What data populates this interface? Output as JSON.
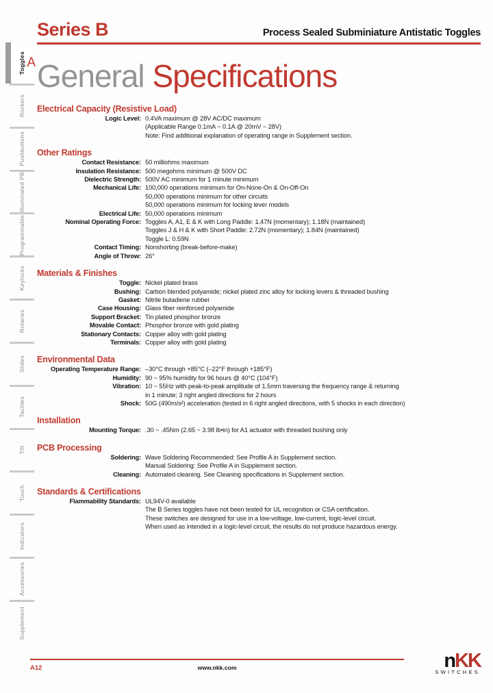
{
  "header": {
    "series": "Series B",
    "subtitle": "Process Sealed Subminiature Antistatic Toggles",
    "title_gray": "General ",
    "title_red": "Specifications"
  },
  "sidebar": {
    "active_letter": "A",
    "items": [
      {
        "label": "Toggles",
        "active": true
      },
      {
        "label": "Rockers",
        "active": false
      },
      {
        "label": "Pushbuttons",
        "active": false
      },
      {
        "label": "Illuminated PB",
        "active": false
      },
      {
        "label": "Programmable",
        "active": false
      },
      {
        "label": "Keylocks",
        "active": false
      },
      {
        "label": "Rotaries",
        "active": false
      },
      {
        "label": "Slides",
        "active": false
      },
      {
        "label": "Tactiles",
        "active": false
      },
      {
        "label": "Tilt",
        "active": false
      },
      {
        "label": "Touch",
        "active": false
      },
      {
        "label": "Indicators",
        "active": false
      },
      {
        "label": "Accessories",
        "active": false
      },
      {
        "label": "Supplement",
        "active": false
      }
    ]
  },
  "sections": [
    {
      "title": "Electrical Capacity (Resistive Load)",
      "rows": [
        {
          "label": "Logic Level:",
          "values": [
            "0.4VA maximum @ 28V AC/DC maximum",
            "(Applicable Range 0.1mA ~ 0.1A @ 20mV ~ 28V)",
            "Note:  Find additional explanation of operating range in Supplement section."
          ]
        }
      ]
    },
    {
      "title": "Other Ratings",
      "rows": [
        {
          "label": "Contact Resistance:",
          "values": [
            "50 milliohms maximum"
          ]
        },
        {
          "label": "Insulation Resistance:",
          "values": [
            "500 megohms minimum @ 500V DC"
          ]
        },
        {
          "label": "Dielectric Strength:",
          "values": [
            "500V AC minimum for 1 minute minimum"
          ]
        },
        {
          "label": "Mechanical Life:",
          "values": [
            "100,000 operations minimum for On-None-On & On-Off-On",
            "50,000 operations minimum for other circuits",
            "50,000 operations minimum for locking lever models"
          ]
        },
        {
          "label": "Electrical Life:",
          "values": [
            "50,000 operations minimum"
          ]
        },
        {
          "label": "Nominal Operating Force:",
          "values": [
            "Toggles A, A1, E & K with Long Paddle: 1.47N (momentary); 1.18N (maintained)",
            "Toggles J & H & K with Short Paddle: 2.72N (momentary); 1.84N (maintained)",
            "Toggle L: 0.59N"
          ]
        },
        {
          "label": "Contact Timing:",
          "values": [
            "Nonshorting (break-before-make)"
          ]
        },
        {
          "label": "Angle of Throw:",
          "values": [
            "26°"
          ]
        }
      ]
    },
    {
      "title": "Materials & Finishes",
      "rows": [
        {
          "label": "Toggle:",
          "values": [
            "Nickel plated brass"
          ]
        },
        {
          "label": "Bushing:",
          "values": [
            "Carbon blended polyamide; nickel plated zinc alloy for locking levers & threaded bushing"
          ]
        },
        {
          "label": "Gasket:",
          "values": [
            "Nitrile butadiene rubber"
          ]
        },
        {
          "label": "Case Housing:",
          "values": [
            "Glass fiber reinforced polyamide"
          ]
        },
        {
          "label": "Support Bracket:",
          "values": [
            "Tin plated phosphor bronze"
          ]
        },
        {
          "label": "Movable Contact:",
          "values": [
            "Phosphor bronze with gold plating"
          ]
        },
        {
          "label": "Stationary Contacts:",
          "values": [
            "Copper alloy with gold plating"
          ]
        },
        {
          "label": "Terminals:",
          "values": [
            "Copper alloy with gold plating"
          ]
        }
      ]
    },
    {
      "title": "Environmental Data",
      "rows": [
        {
          "label": "Operating Temperature Range:",
          "values": [
            "–30°C through +85°C (–22°F through +185°F)"
          ]
        },
        {
          "label": "Humidity:",
          "values": [
            "90 ~ 95% humidity for 96 hours @ 40°C (104°F)"
          ]
        },
        {
          "label": "Vibration:",
          "values": [
            "10 ~ 55Hz with peak-to-peak amplitude of 1.5mm traversing the frequency range & returning",
            "in 1 minute; 3 right angled directions for 2 hours"
          ]
        },
        {
          "label": "Shock:",
          "values": [
            "50G (490m/s²) acceleration (tested in 6 right angled directions, with 5 shocks in each direction)"
          ]
        }
      ]
    },
    {
      "title": "Installation",
      "rows": [
        {
          "label": "Mounting Torque:",
          "values": [
            ".30 ~ .45Nm (2.65 ~ 3.98 lb•in) for A1 actuator with threaded bushing only"
          ]
        }
      ]
    },
    {
      "title": "PCB Processing",
      "rows": [
        {
          "label": "Soldering:",
          "values": [
            "Wave Soldering Recommended:  See Profile A in Supplement section.",
            "Manual Soldering: See Profile A in Supplement section."
          ]
        },
        {
          "label": "Cleaning:",
          "values": [
            "Automated cleaning.  See Cleaning specifications in Supplement section."
          ]
        }
      ]
    },
    {
      "title": "Standards & Certifications",
      "rows": [
        {
          "label": "Flammability Standards:",
          "values": [
            "UL94V-0 available",
            "The B Series toggles have not been tested for UL recognition or CSA certification.",
            "These switches are designed for use in a low-voltage, low-current, logic-level circuit.",
            "When used as intended in a logic-level circuit, the results do not produce hazardous energy."
          ]
        }
      ]
    }
  ],
  "footer": {
    "page_number": "A12",
    "website": "www.nkk.com",
    "logo_n": "n",
    "logo_kk": "KK",
    "logo_sub": "SWITCHES"
  },
  "colors": {
    "brand_red": "#c0392f",
    "title_gray": "#949494",
    "tab_gray": "#8a8a8a"
  }
}
